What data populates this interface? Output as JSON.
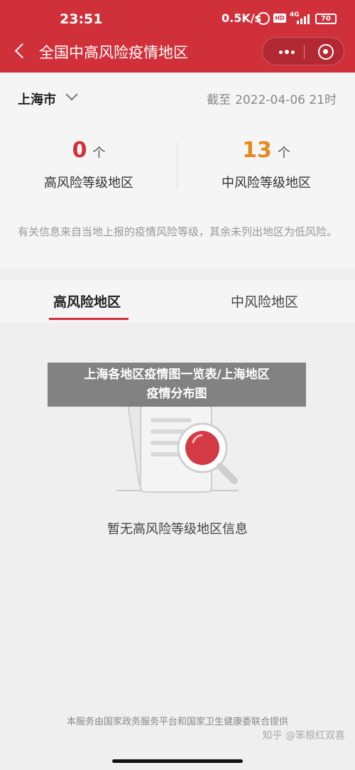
{
  "status_bar": {
    "time": "23:51",
    "network_speed": "0.5K/s",
    "hd_badge": "HD",
    "signal_label": "4G",
    "battery": "70"
  },
  "header": {
    "title": "全国中高风险疫情地区",
    "back_icon": "back-arrow-icon",
    "more_icon": "more-dots-icon",
    "target_icon": "target-icon",
    "accent_color": "#d0303a"
  },
  "info": {
    "city": "上海市",
    "as_of_label": "截至",
    "as_of_time": "2022-04-06 21时",
    "high_risk": {
      "count": "0",
      "unit": "个",
      "label": "高风险等级地区",
      "color": "#d0303a"
    },
    "mid_risk": {
      "count": "13",
      "unit": "个",
      "label": "中风险等级地区",
      "color": "#e58a1f"
    },
    "note": "有关信息来自当地上报的疫情风险等级，其余未列出地区为低风险。"
  },
  "tabs": [
    {
      "label": "高风险地区",
      "active": true
    },
    {
      "label": "中风险地区",
      "active": false
    }
  ],
  "empty_state": {
    "message": "暂无高风险等级地区信息",
    "illustration": "document-magnifier-icon"
  },
  "banner": {
    "line1": "上海各地区疫情图一览表/上海地区",
    "line2": "疫情分布图"
  },
  "footer": {
    "service_note": "本服务由国家政务服务平台和国家卫生健康委联合提供",
    "watermark": "知乎 @笨根红双喜"
  }
}
